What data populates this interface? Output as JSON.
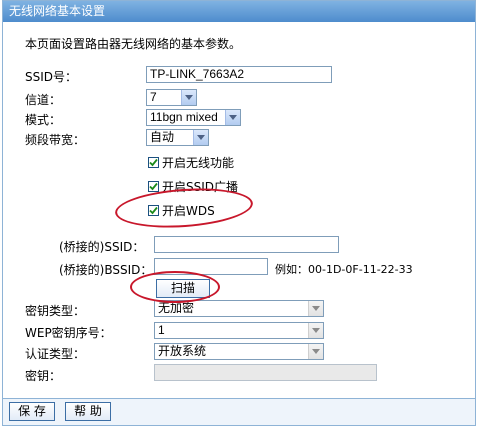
{
  "window": {
    "title": "无线网络基本设置",
    "description": "本页面设置路由器无线网络的基本参数。"
  },
  "form": {
    "ssid_label": "SSID号：",
    "ssid_value": "TP-LINK_7663A2",
    "channel_label": "信道：",
    "channel_value": "7",
    "mode_label": "模式：",
    "mode_value": "11bgn mixed",
    "bandwidth_label": "频段带宽：",
    "bandwidth_value": "自动",
    "enable_wireless_label": "开启无线功能",
    "enable_ssid_broadcast_label": "开启SSID广播",
    "enable_wds_label": "开启WDS",
    "bridged_ssid_label": "(桥接的)SSID：",
    "bridged_ssid_value": "",
    "bridged_bssid_label": "(桥接的)BSSID：",
    "bridged_bssid_value": "",
    "bssid_example": "例如：00-1D-0F-11-22-33",
    "scan_label": "扫描",
    "key_type_label": "密钥类型：",
    "key_type_value": "无加密",
    "wep_index_label": "WEP密钥序号：",
    "wep_index_value": "1",
    "auth_type_label": "认证类型：",
    "auth_type_value": "开放系统",
    "key_label": "密钥：",
    "key_value": ""
  },
  "checkboxes": {
    "enable_wireless": true,
    "enable_ssid_broadcast": true,
    "enable_wds": true
  },
  "footer": {
    "save_label": "保 存",
    "help_label": "帮 助"
  },
  "colors": {
    "title_bar": "#4e8ccd",
    "annotation_red": "#c8172b",
    "input_border": "#7f9db9"
  }
}
